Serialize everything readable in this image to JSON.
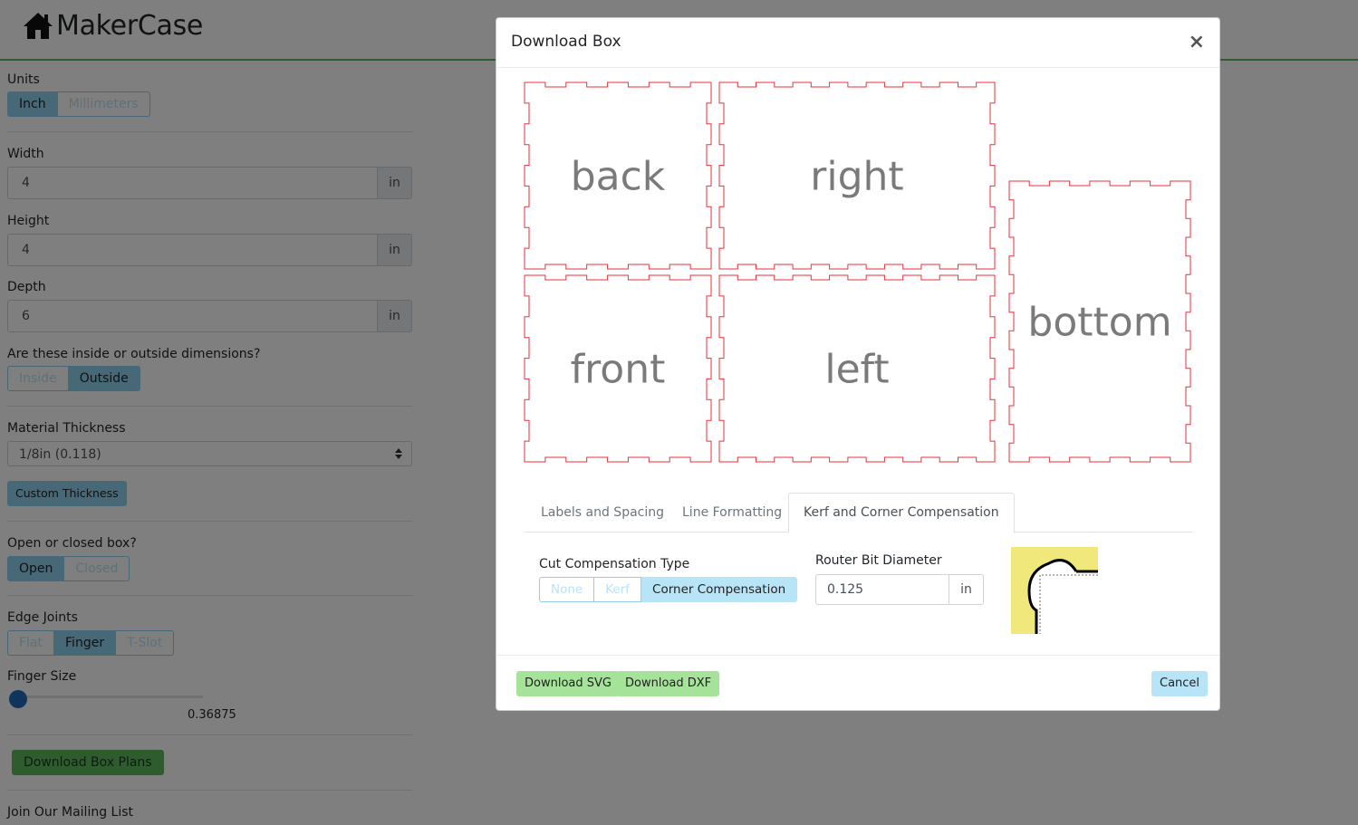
{
  "app": {
    "title": "MakerCase"
  },
  "sidebar": {
    "units": {
      "label": "Units",
      "options": [
        "Inch",
        "Millimeters"
      ],
      "selected": "Inch"
    },
    "width": {
      "label": "Width",
      "value": "4",
      "unit": "in"
    },
    "height": {
      "label": "Height",
      "value": "4",
      "unit": "in"
    },
    "depth": {
      "label": "Depth",
      "value": "6",
      "unit": "in"
    },
    "dimensions": {
      "label": "Are these inside or outside dimensions?",
      "options": [
        "Inside",
        "Outside"
      ],
      "selected": "Outside"
    },
    "material": {
      "label": "Material Thickness",
      "selected": "1/8in (0.118)",
      "custom_label": "Custom Thickness"
    },
    "box_type": {
      "label": "Open or closed box?",
      "options": [
        "Open",
        "Closed"
      ],
      "selected": "Open"
    },
    "edge_joints": {
      "label": "Edge Joints",
      "options": [
        "Flat",
        "Finger",
        "T-Slot"
      ],
      "selected": "Finger"
    },
    "finger_size": {
      "label": "Finger Size",
      "value": "0.36875"
    },
    "download_plans_label": "Download Box Plans",
    "mailing_label": "Join Our Mailing List"
  },
  "modal": {
    "title": "Download Box",
    "close_glyph": "×",
    "panels": [
      "back",
      "right",
      "front",
      "left",
      "bottom"
    ],
    "tabs": [
      "Labels and Spacing",
      "Line Formatting",
      "Kerf and Corner Compensation"
    ],
    "active_tab": "Kerf and Corner Compensation",
    "compensation": {
      "label": "Cut Compensation Type",
      "options": [
        "None",
        "Kerf",
        "Corner Compensation"
      ],
      "selected": "Corner Compensation"
    },
    "router_bit": {
      "label": "Router Bit Diameter",
      "value": "0.125",
      "unit": "in"
    },
    "buttons": {
      "svg": "Download SVG",
      "dxf": "Download DXF",
      "cancel": "Cancel"
    }
  },
  "colors": {
    "cut_line": "#e8323c",
    "accent_green": "#5cb85c",
    "accent_blue": "#8fd0ec",
    "corner_bg": "#f0e87a"
  }
}
